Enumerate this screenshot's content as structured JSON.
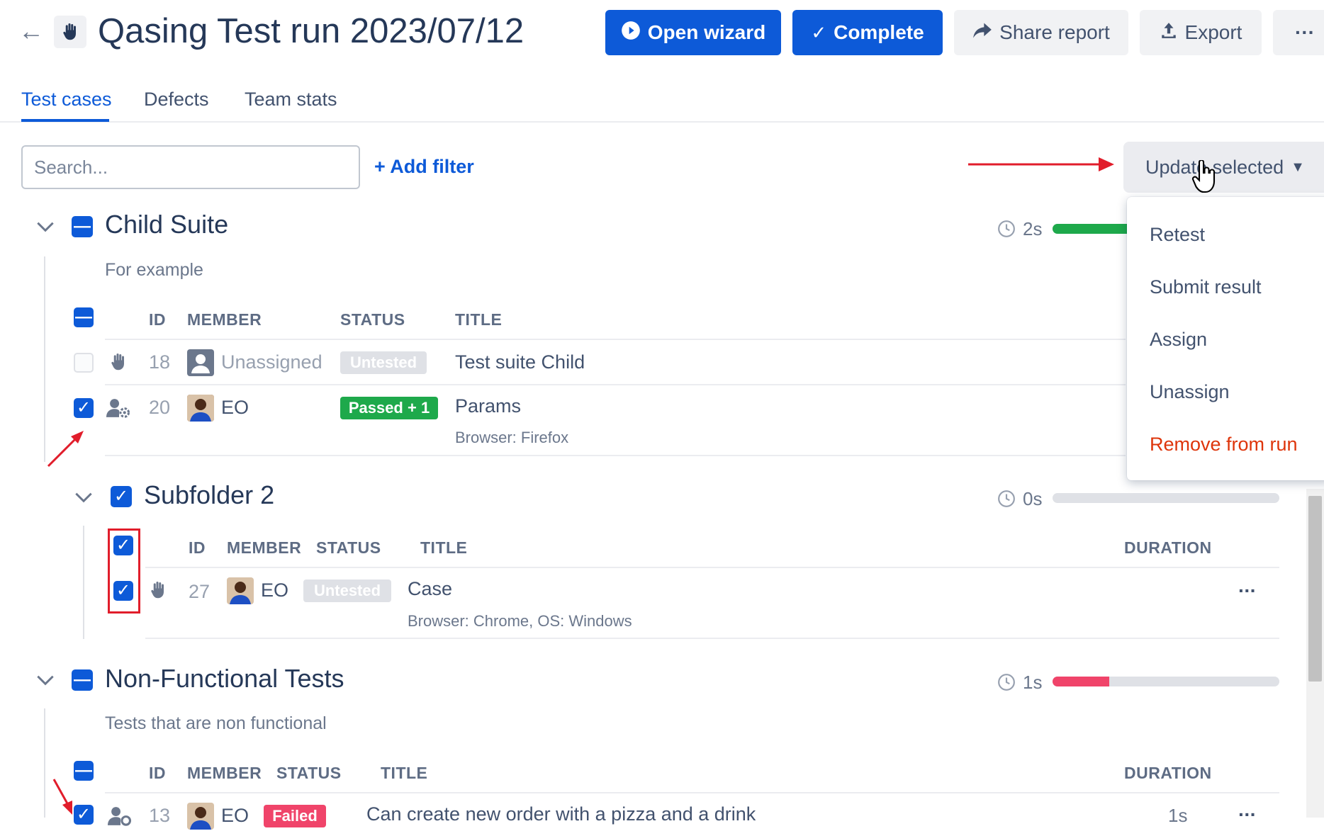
{
  "header": {
    "title": "Qasing Test run 2023/07/12",
    "open_wizard": "Open wizard",
    "complete": "Complete",
    "share_report": "Share report",
    "export": "Export",
    "more": "···"
  },
  "tabs": [
    "Test cases",
    "Defects",
    "Team stats"
  ],
  "toolbar": {
    "search_placeholder": "Search...",
    "add_filter": "+ Add filter",
    "update_selected": "Update selected"
  },
  "menu": {
    "items": [
      "Retest",
      "Submit result",
      "Assign",
      "Unassign",
      "Remove from run"
    ],
    "danger_color": "#de350b"
  },
  "columns": {
    "id": "ID",
    "member": "MEMBER",
    "status": "STATUS",
    "title": "TITLE",
    "duration": "DURATION"
  },
  "suites": [
    {
      "title": "Child Suite",
      "description": "For example",
      "duration": "2s",
      "progress": {
        "passed": 0.45,
        "failed": 0
      },
      "rows": [
        {
          "id": "18",
          "member": "Unassigned",
          "status": "Untested",
          "title": "Test suite Child",
          "meta": "",
          "checked": false
        },
        {
          "id": "20",
          "member": "EO",
          "status": "Passed + 1",
          "title": "Params",
          "meta": "Browser: Firefox",
          "checked": true
        }
      ]
    },
    {
      "title": "Subfolder 2",
      "description": "",
      "duration": "0s",
      "progress": {
        "passed": 0,
        "failed": 0
      },
      "rows": [
        {
          "id": "27",
          "member": "EO",
          "status": "Untested",
          "title": "Case",
          "meta": "Browser: Chrome, OS: Windows",
          "checked": true,
          "row_more": "···"
        }
      ]
    },
    {
      "title": "Non-Functional Tests",
      "description": "Tests that are non functional",
      "duration": "1s",
      "progress": {
        "passed": 0,
        "failed": 0.25
      },
      "rows": [
        {
          "id": "13",
          "member": "EO",
          "status": "Failed",
          "title": "Can create new order with a pizza and a drink",
          "meta": "",
          "checked": true,
          "duration": "1s",
          "row_more": "···"
        }
      ]
    }
  ],
  "colors": {
    "primary": "#0d5ad8",
    "passed": "#1ea94b",
    "failed": "#f0446a",
    "untested": "#dfe1e6",
    "annotation": "#e11d2b"
  }
}
